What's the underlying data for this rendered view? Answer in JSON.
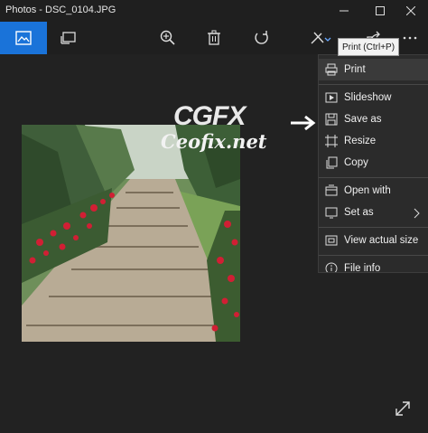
{
  "window": {
    "title": "Photos - DSC_0104.JPG"
  },
  "tooltip": {
    "text": "Print (Ctrl+P)"
  },
  "watermark": {
    "logo": "CGFX",
    "site": "Ceofix.net"
  },
  "menu": {
    "items": [
      {
        "label": "Print",
        "icon": "printer-icon"
      },
      {
        "label": "Slideshow",
        "icon": "slideshow-icon"
      },
      {
        "label": "Save as",
        "icon": "save-icon"
      },
      {
        "label": "Resize",
        "icon": "resize-icon"
      },
      {
        "label": "Copy",
        "icon": "copy-icon"
      },
      {
        "label": "Open with",
        "icon": "open-with-icon"
      },
      {
        "label": "Set as",
        "icon": "set-as-icon"
      },
      {
        "label": "View actual size",
        "icon": "actual-size-icon"
      },
      {
        "label": "File info",
        "icon": "info-icon"
      }
    ]
  },
  "colors": {
    "accent": "#1a73d9",
    "background": "#1f1f1f",
    "menu_bg": "#2b2b2b"
  }
}
